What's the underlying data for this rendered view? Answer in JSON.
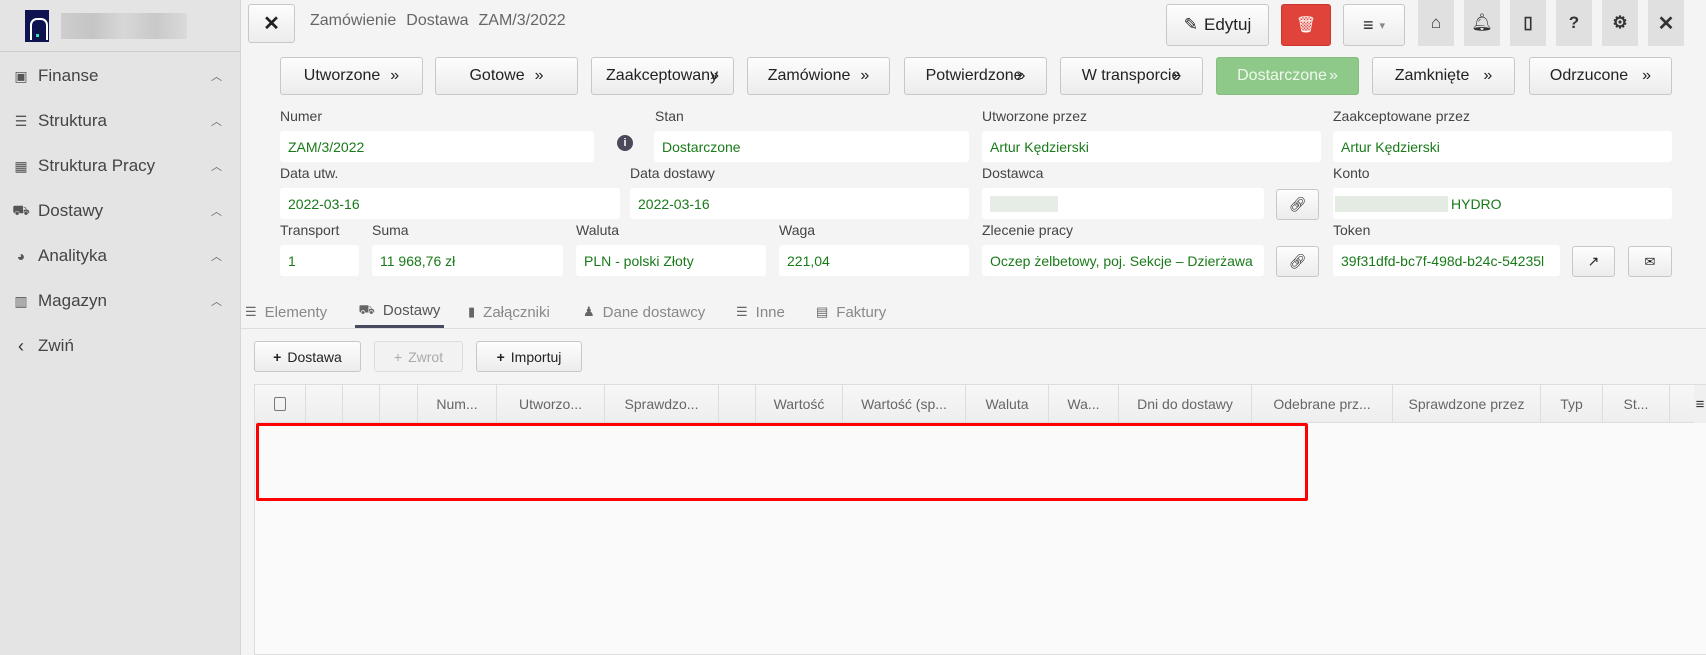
{
  "sidebar": {
    "items": [
      {
        "label": "Finanse",
        "icon": "money-icon"
      },
      {
        "label": "Struktura",
        "icon": "structure-icon"
      },
      {
        "label": "Struktura Pracy",
        "icon": "building-icon"
      },
      {
        "label": "Dostawy",
        "icon": "truck-icon"
      },
      {
        "label": "Analityka",
        "icon": "dashboard-icon"
      },
      {
        "label": "Magazyn",
        "icon": "warehouse-icon"
      },
      {
        "label": "Zwiń",
        "icon": "chevron-left-icon"
      }
    ]
  },
  "header": {
    "breadcrumb": [
      "Zamówienie",
      "Dostawa",
      "ZAM/3/2022"
    ],
    "edit_label": "Edytuj"
  },
  "statuses": [
    "Utworzone",
    "Gotowe",
    "Zaakceptowany",
    "Zamówione",
    "Potwierdzone",
    "W transporcie",
    "Dostarczone",
    "Zamknięte",
    "Odrzucone"
  ],
  "active_status": "Dostarczone",
  "colors": {
    "active_status": "#8fc98a",
    "delete": "#e0433a",
    "value_text": "#197a19",
    "highlight": "#ff0000"
  },
  "form": {
    "numer": {
      "label": "Numer",
      "value": "ZAM/3/2022"
    },
    "stan": {
      "label": "Stan",
      "value": "Dostarczone"
    },
    "utworzone_przez": {
      "label": "Utworzone przez",
      "value": "Artur Kędzierski"
    },
    "zaakceptowane_przez": {
      "label": "Zaakceptowane przez",
      "value": "Artur Kędzierski"
    },
    "data_utw": {
      "label": "Data utw.",
      "value": "2022-03-16"
    },
    "data_dostawy": {
      "label": "Data dostawy",
      "value": "2022-03-16"
    },
    "dostawca": {
      "label": "Dostawca",
      "value": ""
    },
    "konto": {
      "label": "Konto",
      "value": "HYDRO"
    },
    "transport": {
      "label": "Transport",
      "value": "1"
    },
    "suma": {
      "label": "Suma",
      "value": "11 968,76 zł"
    },
    "waluta": {
      "label": "Waluta",
      "value": "PLN - polski Złoty"
    },
    "waga": {
      "label": "Waga",
      "value": "221,04"
    },
    "zlecenie": {
      "label": "Zlecenie pracy",
      "value": "Oczep żelbetowy, poj. Sekcje – Dzierżawa"
    },
    "token": {
      "label": "Token",
      "value": "39f31dfd-bc7f-498d-b24c-54235l"
    }
  },
  "tabs": [
    {
      "label": "Elementy"
    },
    {
      "label": "Dostawy"
    },
    {
      "label": "Załączniki"
    },
    {
      "label": "Dane dostawcy"
    },
    {
      "label": "Inne"
    },
    {
      "label": "Faktury"
    }
  ],
  "active_tab": "Dostawy",
  "actions": {
    "dostawa": "Dostawa",
    "zwrot": "Zwrot",
    "importuj": "Importuj"
  },
  "table": {
    "columns": [
      "",
      "",
      "",
      "",
      "Num...",
      "Utworzo...",
      "Sprawdzo...",
      "",
      "Wartość",
      "Wartość (sp...",
      "Waluta",
      "Wa...",
      "Dni do dostawy",
      "Odebrane prz...",
      "Sprawdzone przez",
      "Typ",
      "St..."
    ],
    "rows": []
  }
}
